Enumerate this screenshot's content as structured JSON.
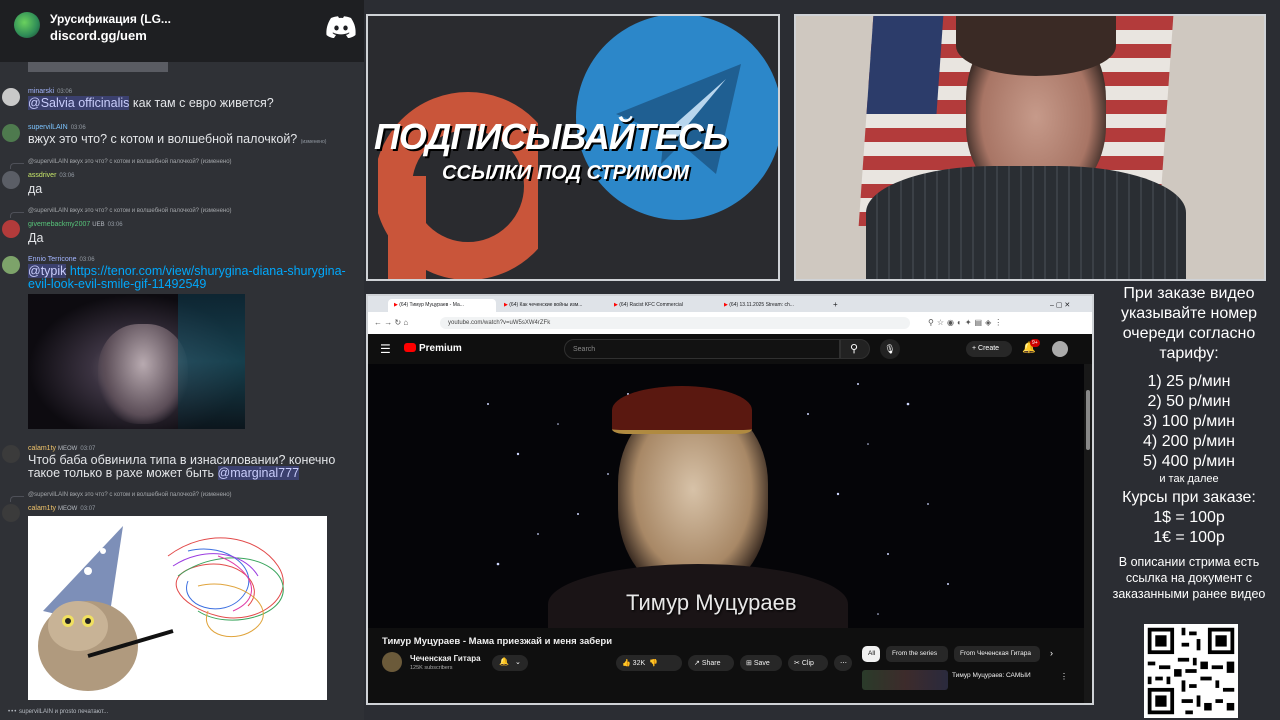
{
  "discord": {
    "server_name": "Урусификация (LG...",
    "invite": "discord.gg/uem",
    "typing": "supervilLAIN и prosto печатают..."
  },
  "messages": [
    {
      "user": "minarski",
      "time": "03:06",
      "text_mention": "@Salvia officinalis",
      "text": " как там с евро живется?"
    },
    {
      "user": "supervilLAIN",
      "time": "03:06",
      "text": "вжух это что? с котом и волшебной палочкой?",
      "edited": "(изменено)"
    },
    {
      "reply": "@supervilLAIN вжух это что? с котом и волшебной палочкой?",
      "reply_edited": "(изменено)",
      "user": "assdriver",
      "time": "03:06",
      "text": "да"
    },
    {
      "reply": "@supervilLAIN вжух это что? с котом и волшебной палочкой?",
      "reply_edited": "(изменено)",
      "user": "givemebackmy2007",
      "badge": "UEB",
      "time": "03:06",
      "text": "Да"
    },
    {
      "user": "Ennio Terricone",
      "time": "03:06",
      "text_mention": "@typik",
      "link": "https://tenor.com/view/shurygina-diana-shurygina-evil-look-evil-smile-gif-11492549"
    },
    {
      "user": "calam1ty",
      "badge": "MEOW",
      "time": "03:07",
      "text": "Чтоб баба обвинила типа в изнасиловании? конечно такое только в рахе может быть ",
      "text_mention": "@marginal777"
    },
    {
      "reply": "@supervilLAIN вжух это что? с котом и волшебной палочкой?",
      "reply_edited": "(изменено)",
      "user": "calam1ty",
      "badge": "MEOW",
      "time": "03:07"
    }
  ],
  "banner": {
    "title": "ПОДПИСЫВАЙТЕСЬ",
    "subtitle": "ССЫЛКИ ПОД СТРИМОМ"
  },
  "browser": {
    "tabs": [
      "(64) Тимур Муцураев - Ма...",
      "(64) Как чеченские войны изм...",
      "(64) Racist KFC Commercial",
      "(64) 13.11.2025 Stream: ch..."
    ],
    "url": "youtube.com/watch?v=uW5sXW4rZFk"
  },
  "youtube": {
    "logo": "Premium",
    "search_placeholder": "Search",
    "create": "Create",
    "notif_count": "9+",
    "video_caption": "Тимур Муцураев",
    "title": "Тимур Муцураев - Мама приезжай и меня забери",
    "channel": "Чеченская Гитара",
    "subscribers": "125K subscribers",
    "likes": "32K",
    "share": "Share",
    "save": "Save",
    "clip": "Clip",
    "chips": [
      "All",
      "From the series",
      "From Чеченская Гитара"
    ],
    "rec_title": "Тимур Муцураев: САМЫЙ"
  },
  "info": {
    "intro": "При заказе видео указывайте номер очереди согласно тарифу:",
    "tariffs": [
      "1) 25 р/мин",
      "2) 50 р/мин",
      "3) 100 р/мин",
      "4) 200 р/мин",
      "5) 400 р/мин"
    ],
    "etc": "и так далее",
    "rates_title": "Курсы при заказе:",
    "rates": [
      "1$ = 100р",
      "1€ = 100р"
    ],
    "note": "В описании стрима есть ссылка на документ с заказанными ранее видео"
  },
  "colors": {
    "discord_bg": "#2f3136",
    "youtube_red": "#ff0000",
    "mention": "#c9cdfb",
    "link": "#00a8fc"
  }
}
